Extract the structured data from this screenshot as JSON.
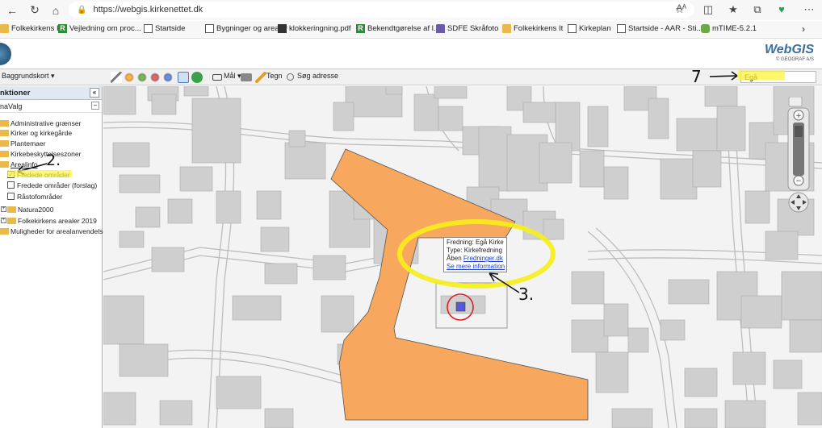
{
  "browser": {
    "url": "https://webgis.kirkenettet.dk",
    "read_aloud": "Aᴬ"
  },
  "bookmarks": [
    {
      "label": "Folkekirkens It",
      "icon": "folder"
    },
    {
      "label": "Vejledning om proc...",
      "icon": "r-logo"
    },
    {
      "label": "Startside",
      "icon": "document"
    },
    {
      "label": "Bygninger og arealer",
      "icon": "document"
    },
    {
      "label": "klokkeringning.pdf",
      "icon": "pdf"
    },
    {
      "label": "Bekendtgørelse af l...",
      "icon": "r-logo"
    },
    {
      "label": "SDFE Skråfoto",
      "icon": "crown"
    },
    {
      "label": "Folkekirkens It",
      "icon": "folder"
    },
    {
      "label": "Kirkeplan",
      "icon": "document"
    },
    {
      "label": "Startside - AAR - Sti...",
      "icon": "document"
    },
    {
      "label": "mTIME-5.2.1",
      "icon": "puzzle"
    }
  ],
  "app": {
    "brand": "WebGIS",
    "brand_sub": "© GEOGRAF A/S"
  },
  "toolbar": {
    "baggrundskort": "Baggrundskort ▾",
    "maal": "Mål ▾",
    "tegn": "Tegn",
    "soeg": "Søg adresse",
    "search_value": "Egå"
  },
  "panel": {
    "title": "nktioner",
    "subtitle": "naValg",
    "items": [
      {
        "label": "Administrative grænser"
      },
      {
        "label": "Kirker og kirkegårde"
      },
      {
        "label": "Plantemaer"
      },
      {
        "label": "Kirkebeskyttelseszoner"
      },
      {
        "label": "Arealinfo"
      },
      {
        "label": "Fredede områder",
        "checked": true
      },
      {
        "label": "Fredede områder (forslag)",
        "checked": false
      },
      {
        "label": "Råstofområder",
        "checked": false
      },
      {
        "label": "Natura2000"
      },
      {
        "label": "Folkekirkens arealer 2019"
      },
      {
        "label": "Muligheder for arealanvendelse"
      }
    ]
  },
  "popup": {
    "line1": "Fredning: Egå Kirke",
    "line2": "Type: Kirkefredning",
    "line3_prefix": "Åben ",
    "line3_link": "Fredninger.dk",
    "line4": "Se mere information"
  },
  "annotations": {
    "a1": "7",
    "a2": "2.",
    "a3": "3."
  },
  "colors": {
    "fredning": "#f7a85e",
    "highlight": "#ffff00",
    "building": "#cfcfcf",
    "circle": "#e02020"
  }
}
